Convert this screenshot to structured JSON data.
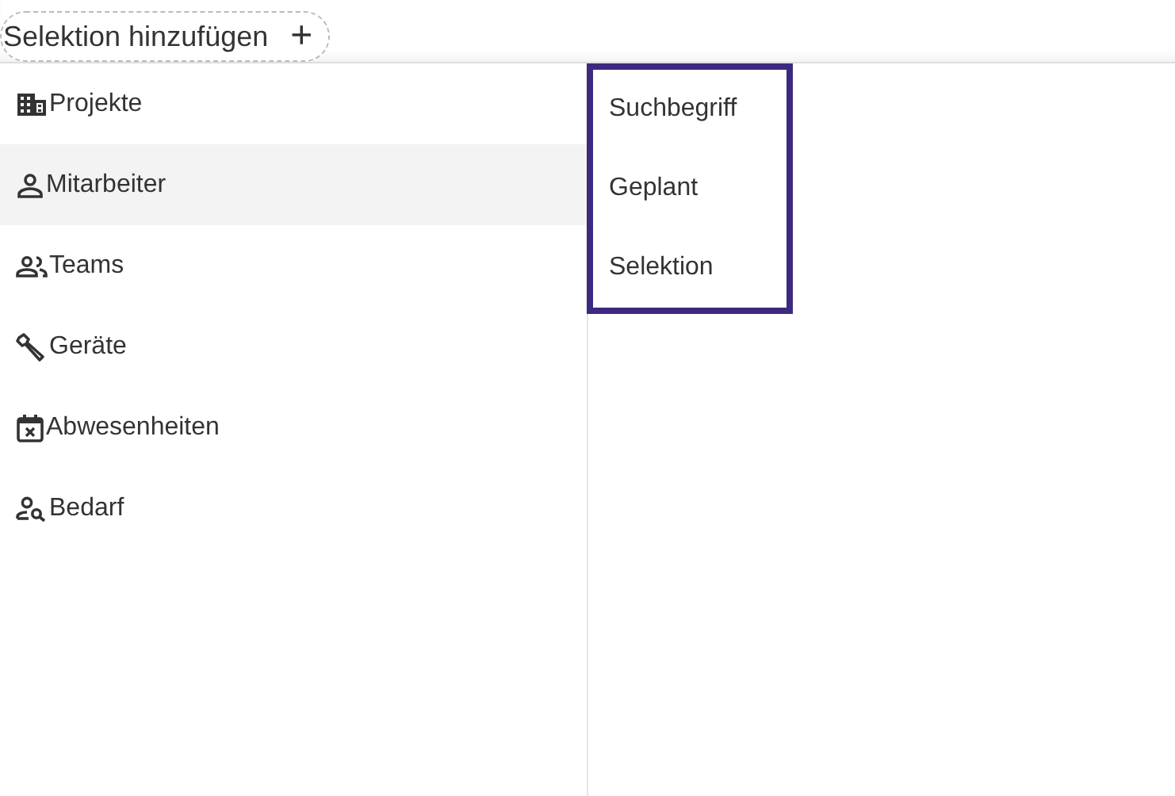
{
  "add_selection_button": {
    "label": "Selektion hinzufügen",
    "icon_text": "+"
  },
  "categories": [
    {
      "label": "Projekte",
      "selected": false
    },
    {
      "label": "Mitarbeiter",
      "selected": true
    },
    {
      "label": "Teams",
      "selected": false
    },
    {
      "label": "Geräte",
      "selected": false
    },
    {
      "label": "Abwesenheiten",
      "selected": false
    },
    {
      "label": "Bedarf",
      "selected": false
    }
  ],
  "submenu": {
    "items": [
      {
        "label": "Suchbegriff"
      },
      {
        "label": "Geplant"
      },
      {
        "label": "Selektion"
      }
    ]
  }
}
